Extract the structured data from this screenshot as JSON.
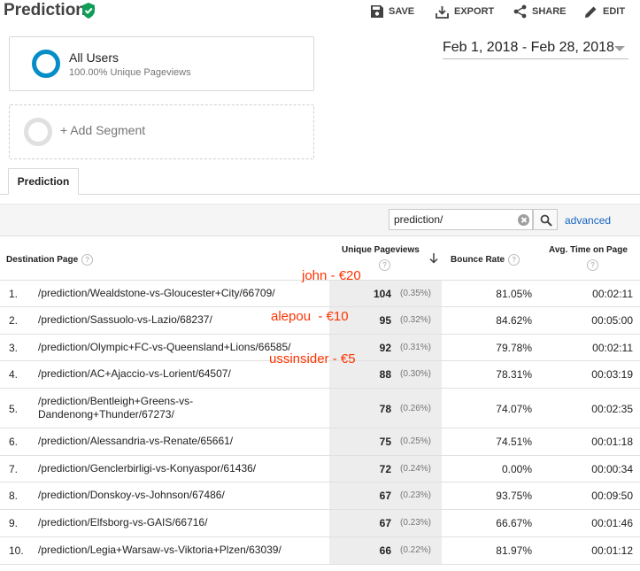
{
  "header": {
    "title": "Prediction",
    "actions": {
      "save": "SAVE",
      "export": "EXPORT",
      "share": "SHARE",
      "edit": "EDIT"
    }
  },
  "segments": {
    "active": {
      "name": "All Users",
      "subtitle": "100.00% Unique Pageviews"
    },
    "add_label": "+ Add Segment",
    "ring_color": "#058dc7"
  },
  "date_range": "Feb 1, 2018 - Feb 28, 2018",
  "tab": "Prediction",
  "filter": {
    "value": "prediction/",
    "advanced_label": "advanced"
  },
  "table": {
    "headers": {
      "page": "Destination Page",
      "unique_pageviews": [
        "Unique Pageviews"
      ],
      "bounce_rate": "Bounce Rate",
      "avg_time": "Avg. Time on Page"
    },
    "rows": [
      {
        "idx": "1.",
        "page": "/prediction/Wealdstone-vs-Gloucester+City/66709/",
        "upv": "104",
        "pct": "(0.35%)",
        "bounce": "81.05%",
        "time": "00:02:11"
      },
      {
        "idx": "2.",
        "page": "/prediction/Sassuolo-vs-Lazio/68237/",
        "upv": "95",
        "pct": "(0.32%)",
        "bounce": "84.62%",
        "time": "00:05:00"
      },
      {
        "idx": "3.",
        "page": "/prediction/Olympic+FC-vs-Queensland+Lions/66585/",
        "upv": "92",
        "pct": "(0.31%)",
        "bounce": "79.78%",
        "time": "00:02:11"
      },
      {
        "idx": "4.",
        "page": "/prediction/AC+Ajaccio-vs-Lorient/64507/",
        "upv": "88",
        "pct": "(0.30%)",
        "bounce": "78.31%",
        "time": "00:03:19"
      },
      {
        "idx": "5.",
        "page": "/prediction/Bentleigh+Greens-vs-Dandenong+Thunder/67273/",
        "upv": "78",
        "pct": "(0.26%)",
        "bounce": "74.07%",
        "time": "00:02:35"
      },
      {
        "idx": "6.",
        "page": "/prediction/Alessandria-vs-Renate/65661/",
        "upv": "75",
        "pct": "(0.25%)",
        "bounce": "74.51%",
        "time": "00:01:18"
      },
      {
        "idx": "7.",
        "page": "/prediction/Genclerbirligi-vs-Konyaspor/61436/",
        "upv": "72",
        "pct": "(0.24%)",
        "bounce": "0.00%",
        "time": "00:00:34"
      },
      {
        "idx": "8.",
        "page": "/prediction/Donskoy-vs-Johnson/67486/",
        "upv": "67",
        "pct": "(0.23%)",
        "bounce": "93.75%",
        "time": "00:09:50"
      },
      {
        "idx": "9.",
        "page": "/prediction/Elfsborg-vs-GAIS/66716/",
        "upv": "67",
        "pct": "(0.23%)",
        "bounce": "66.67%",
        "time": "00:01:46"
      },
      {
        "idx": "10.",
        "page": "/prediction/Legia+Warsaw-vs-Viktoria+Plzen/63039/",
        "upv": "66",
        "pct": "(0.22%)",
        "bounce": "81.97%",
        "time": "00:01:12"
      }
    ]
  },
  "annotations": {
    "note1": "john - €20",
    "note2": "alepou  - €10",
    "note3": "ussinsider - €5",
    "color": "#ff3300"
  }
}
